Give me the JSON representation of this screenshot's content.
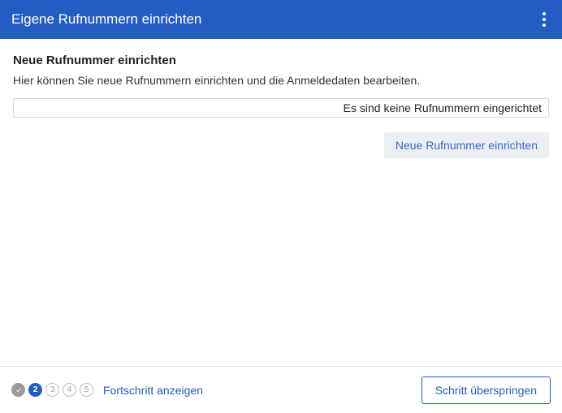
{
  "header": {
    "title": "Eigene Rufnummern einrichten"
  },
  "main": {
    "section_title": "Neue Rufnummer einrichten",
    "section_desc": "Hier können Sie neue Rufnummern einrichten und die Anmeldedaten bearbeiten.",
    "empty_message": "Es sind keine Rufnummern eingerichtet",
    "new_button": "Neue Rufnummer einrichten"
  },
  "footer": {
    "steps": {
      "completed": [
        1
      ],
      "current": 2,
      "current_label": "2",
      "upcoming": [
        "3",
        "4",
        "5"
      ]
    },
    "progress_link": "Fortschritt anzeigen",
    "skip_button": "Schritt überspringen"
  }
}
